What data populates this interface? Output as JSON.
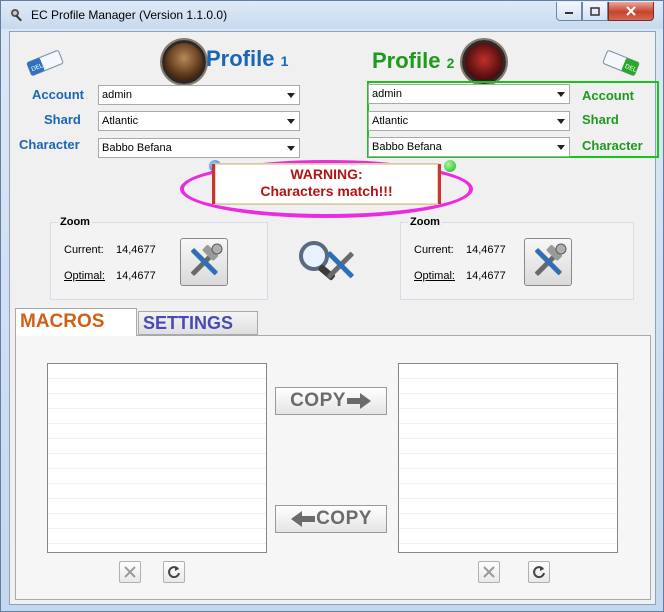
{
  "window": {
    "title": "EC Profile Manager (Version 1.1.0.0)"
  },
  "profile1": {
    "title": "Profile",
    "number": "1",
    "labels": {
      "account": "Account",
      "shard": "Shard",
      "character": "Character"
    },
    "account": "admin",
    "shard": "Atlantic",
    "character": "Babbo Befana"
  },
  "profile2": {
    "title": "Profile",
    "number": "2",
    "labels": {
      "account": "Account",
      "shard": "Shard",
      "character": "Character"
    },
    "account": "admin",
    "shard": "Atlantic",
    "character": "Babbo Befana"
  },
  "warning": {
    "line1": "WARNING:",
    "line2": "Characters match!!!"
  },
  "zoom1": {
    "title": "Zoom",
    "current_label": "Current:",
    "current_value": "14,4677",
    "optimal_label": "Optimal:",
    "optimal_value": "14,4677"
  },
  "zoom2": {
    "title": "Zoom",
    "current_label": "Current:",
    "current_value": "14,4677",
    "optimal_label": "Optimal:",
    "optimal_value": "14,4677"
  },
  "tabs": {
    "macros": "MACROS",
    "settings": "SETTINGS"
  },
  "copy": {
    "right": "COPY",
    "left": "COPY"
  },
  "colors": {
    "blue_label": "#1a67b5",
    "green_label": "#1e9a1e",
    "warning_red": "#b21414",
    "highlight_pink": "#ec2be0",
    "highlight_green": "#19c319"
  }
}
